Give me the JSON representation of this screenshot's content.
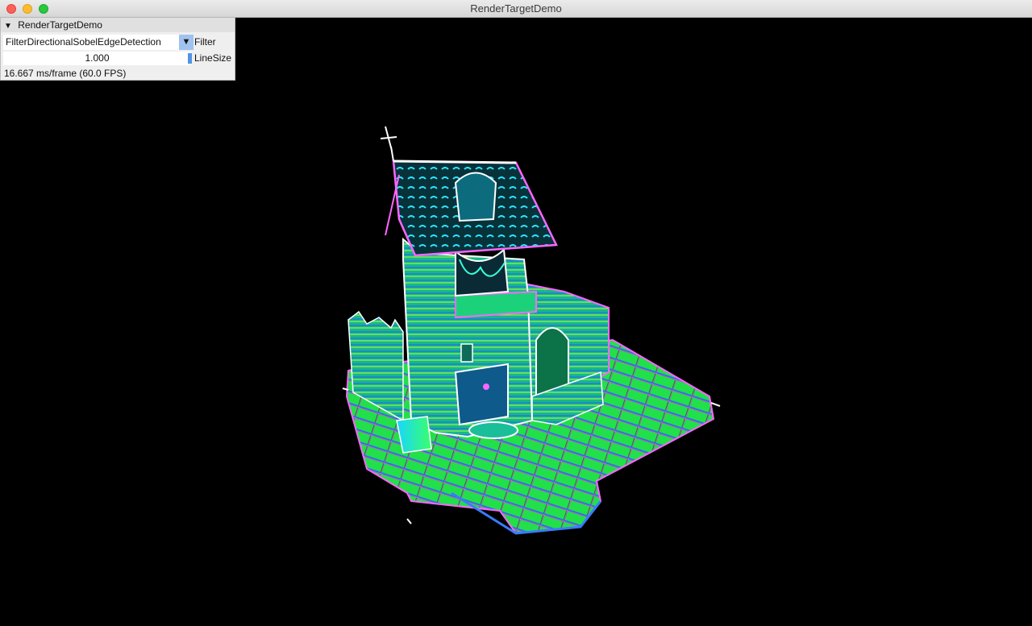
{
  "window": {
    "title": "RenderTargetDemo"
  },
  "panel": {
    "title": "RenderTargetDemo",
    "filter": {
      "selected": "FilterDirectionalSobelEdgeDetection",
      "label": "Filter"
    },
    "line_size": {
      "value_text": "1.000",
      "label": "LineSize"
    },
    "stats": "16.667 ms/frame (60.0 FPS)"
  }
}
